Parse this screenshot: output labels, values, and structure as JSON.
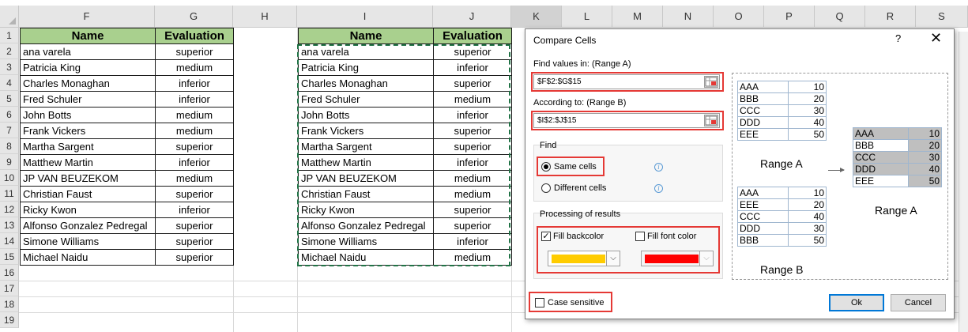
{
  "columns": [
    "F",
    "G",
    "H",
    "I",
    "J",
    "K",
    "L",
    "M",
    "N",
    "O",
    "P",
    "Q",
    "R",
    "S"
  ],
  "rows": [
    "1",
    "2",
    "3",
    "4",
    "5",
    "6",
    "7",
    "8",
    "9",
    "10",
    "11",
    "12",
    "13",
    "14",
    "15",
    "16",
    "17",
    "18",
    "19"
  ],
  "table_a": {
    "headers": [
      "Name",
      "Evaluation"
    ],
    "rows": [
      [
        "ana varela",
        "superior"
      ],
      [
        "Patricia King",
        "medium"
      ],
      [
        "Charles Monaghan",
        "inferior"
      ],
      [
        "Fred Schuler",
        "inferior"
      ],
      [
        "John Botts",
        "medium"
      ],
      [
        "Frank Vickers",
        "medium"
      ],
      [
        "Martha Sargent",
        "superior"
      ],
      [
        "Matthew Martin",
        "inferior"
      ],
      [
        "JP VAN BEUZEKOM",
        "medium"
      ],
      [
        "Christian Faust",
        "superior"
      ],
      [
        "Ricky Kwon",
        "inferior"
      ],
      [
        "Alfonso Gonzalez Pedregal",
        "superior"
      ],
      [
        "Simone Williams",
        "superior"
      ],
      [
        "Michael Naidu",
        "superior"
      ]
    ]
  },
  "table_b": {
    "headers": [
      "Name",
      "Evaluation"
    ],
    "rows": [
      [
        "ana varela",
        "superior"
      ],
      [
        "Patricia King",
        "inferior"
      ],
      [
        "Charles Monaghan",
        "superior"
      ],
      [
        "Fred Schuler",
        "medium"
      ],
      [
        "John Botts",
        "inferior"
      ],
      [
        "Frank Vickers",
        "superior"
      ],
      [
        "Martha Sargent",
        "superior"
      ],
      [
        "Matthew Martin",
        "inferior"
      ],
      [
        "JP VAN BEUZEKOM",
        "medium"
      ],
      [
        "Christian Faust",
        "medium"
      ],
      [
        "Ricky Kwon",
        "superior"
      ],
      [
        "Alfonso Gonzalez Pedregal",
        "superior"
      ],
      [
        "Simone Williams",
        "inferior"
      ],
      [
        "Michael Naidu",
        "medium"
      ]
    ]
  },
  "dialog": {
    "title": "Compare Cells",
    "help": "?",
    "close": "✕",
    "find_values_label": "Find values in: (Range A)",
    "range_a_value": "$F$2:$G$15",
    "according_label": "According to: (Range B)",
    "range_b_value": "$I$2:$J$15",
    "find_group": "Find",
    "same_cells": "Same cells",
    "different_cells": "Different cells",
    "processing_group": "Processing of results",
    "fill_backcolor": "Fill backcolor",
    "fill_font_color": "Fill font color",
    "backcolor_hex": "#ffcc00",
    "fontcolor_hex": "#ff0000",
    "case_sensitive": "Case sensitive",
    "ok": "Ok",
    "cancel": "Cancel",
    "selected_option": "same_cells",
    "fill_backcolor_checked": true,
    "fill_font_color_checked": false,
    "case_sensitive_checked": false
  },
  "preview": {
    "range_a": [
      [
        "AAA",
        "10"
      ],
      [
        "BBB",
        "20"
      ],
      [
        "CCC",
        "30"
      ],
      [
        "DDD",
        "40"
      ],
      [
        "EEE",
        "50"
      ]
    ],
    "range_b": [
      [
        "AAA",
        "10"
      ],
      [
        "EEE",
        "20"
      ],
      [
        "CCC",
        "40"
      ],
      [
        "DDD",
        "30"
      ],
      [
        "BBB",
        "50"
      ]
    ],
    "result": [
      [
        "AAA",
        "10"
      ],
      [
        "BBB",
        "20"
      ],
      [
        "CCC",
        "30"
      ],
      [
        "DDD",
        "40"
      ],
      [
        "EEE",
        "50"
      ]
    ],
    "label_a": "Range A",
    "label_b": "Range B",
    "label_result": "Range A"
  },
  "accent_red": "#e53935",
  "header_green": "#a9d08e"
}
